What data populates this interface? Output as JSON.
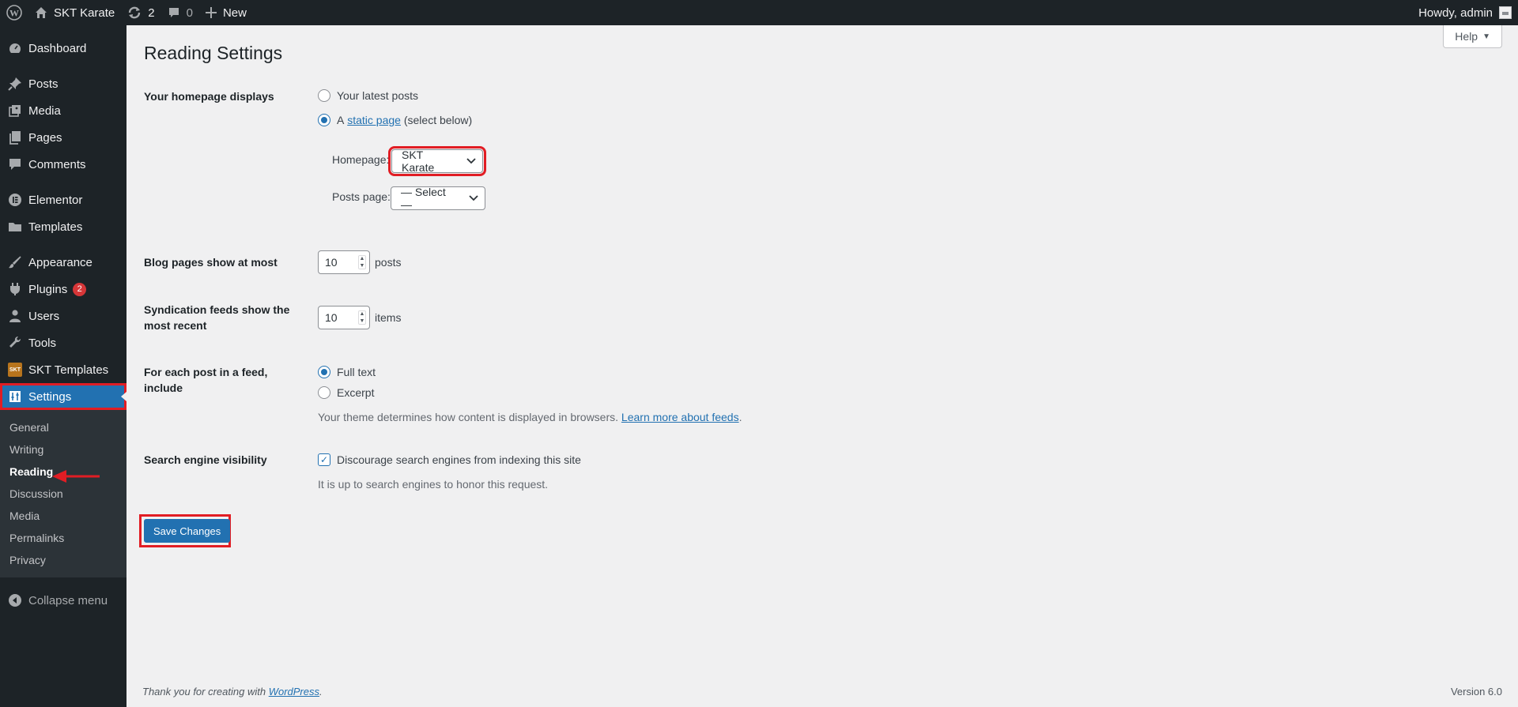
{
  "adminbar": {
    "site_name": "SKT Karate",
    "updates_count": "2",
    "comments_count": "0",
    "new_label": "New",
    "greeting": "Howdy, admin"
  },
  "sidebar": {
    "items": [
      {
        "label": "Dashboard",
        "icon": "dashboard-icon"
      },
      {
        "label": "Posts",
        "icon": "pin-icon"
      },
      {
        "label": "Media",
        "icon": "media-icon"
      },
      {
        "label": "Pages",
        "icon": "pages-icon"
      },
      {
        "label": "Comments",
        "icon": "comment-icon"
      },
      {
        "label": "Elementor",
        "icon": "elementor-icon"
      },
      {
        "label": "Templates",
        "icon": "folder-icon"
      },
      {
        "label": "Appearance",
        "icon": "brush-icon"
      },
      {
        "label": "Plugins",
        "icon": "plugin-icon",
        "badge": "2"
      },
      {
        "label": "Users",
        "icon": "user-icon"
      },
      {
        "label": "Tools",
        "icon": "wrench-icon"
      },
      {
        "label": "SKT Templates",
        "icon": "skt-icon",
        "icon_text": "SKT"
      },
      {
        "label": "Settings",
        "icon": "settings-icon"
      }
    ],
    "submenu": [
      "General",
      "Writing",
      "Reading",
      "Discussion",
      "Media",
      "Permalinks",
      "Privacy"
    ],
    "collapse_label": "Collapse menu"
  },
  "page": {
    "help_label": "Help",
    "title": "Reading Settings",
    "homepage_displays": {
      "label": "Your homepage displays",
      "option_latest": "Your latest posts",
      "option_static_prefix": "A",
      "option_static_link": "static page",
      "option_static_suffix": "(select below)",
      "homepage_label": "Homepage:",
      "homepage_value": "SKT Karate",
      "posts_page_label": "Posts page:",
      "posts_page_value": "— Select —"
    },
    "blog_pages": {
      "label": "Blog pages show at most",
      "value": "10",
      "unit": "posts"
    },
    "syndication": {
      "label": "Syndication feeds show the most recent",
      "value": "10",
      "unit": "items"
    },
    "feed_include": {
      "label": "For each post in a feed, include",
      "option_full": "Full text",
      "option_excerpt": "Excerpt",
      "desc_text": "Your theme determines how content is displayed in browsers.",
      "desc_link": "Learn more about feeds",
      "desc_end": "."
    },
    "search_visibility": {
      "label": "Search engine visibility",
      "checkbox_label": "Discourage search engines from indexing this site",
      "desc": "It is up to search engines to honor this request."
    },
    "save_label": "Save Changes"
  },
  "footer": {
    "thanks_prefix": "Thank you for creating with",
    "thanks_link": "WordPress",
    "thanks_end": ".",
    "version": "Version 6.0"
  },
  "colors": {
    "accent": "#2271b1",
    "highlight": "#e11d24",
    "sidebar_bg": "#1d2327"
  }
}
